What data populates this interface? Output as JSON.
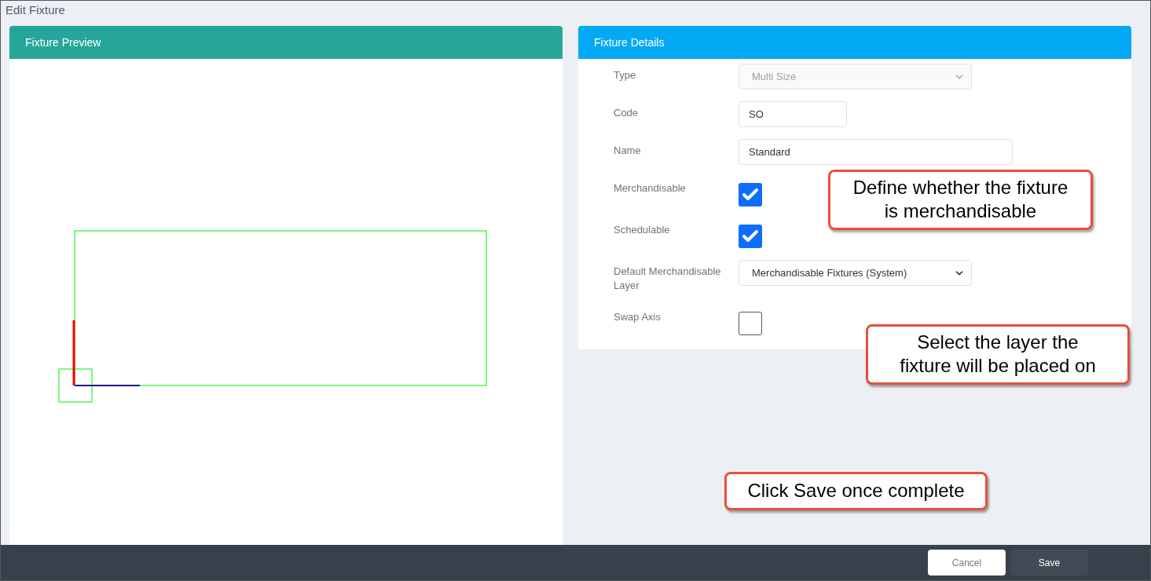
{
  "title": "Edit Fixture",
  "preview": {
    "title": "Fixture Preview"
  },
  "details": {
    "title": "Fixture Details",
    "fields": [
      {
        "kind": "select",
        "label": "Type",
        "value": "Multi Size",
        "disabled": true
      },
      {
        "kind": "text",
        "label": "Code",
        "value": "SO"
      },
      {
        "kind": "text",
        "label": "Name",
        "value": "Standard"
      },
      {
        "kind": "checkbox",
        "label": "Merchandisable",
        "checked": true
      },
      {
        "kind": "checkbox",
        "label": "Schedulable",
        "checked": true
      },
      {
        "kind": "select",
        "label": "Default Merchandisable Layer",
        "value": "Merchandisable Fixtures (System)",
        "disabled": false
      },
      {
        "kind": "checkbox",
        "label": "Swap Axis",
        "checked": false
      }
    ]
  },
  "buttons": [
    {
      "label": "Cancel",
      "kind": "secondary"
    },
    {
      "label": "Save",
      "kind": "primary"
    }
  ],
  "callouts": [
    {
      "text": "Define whether the fixture is merchandisable"
    },
    {
      "text": "Select the layer the fixture will be placed on"
    },
    {
      "text": "Click Save once complete"
    }
  ]
}
